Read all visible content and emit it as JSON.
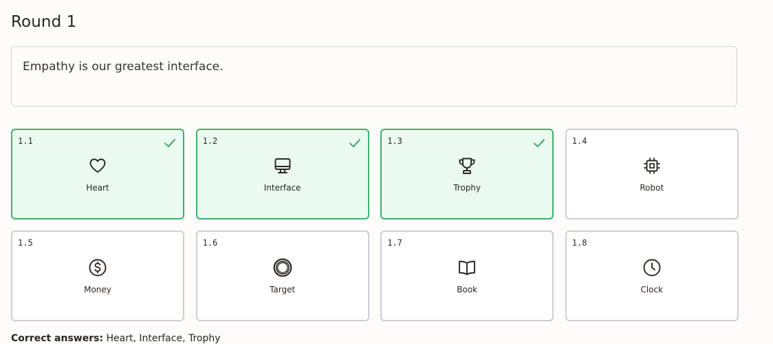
{
  "title": "Round 1",
  "prompt": "Empathy is our greatest interface.",
  "colors": {
    "selected_border": "#3bb26a",
    "selected_bg": "#ebfaf1",
    "check": "#2e9e58"
  },
  "options": [
    {
      "num": "1.1",
      "label": "Heart",
      "icon": "heart-icon",
      "selected": true
    },
    {
      "num": "1.2",
      "label": "Interface",
      "icon": "monitor-icon",
      "selected": true
    },
    {
      "num": "1.3",
      "label": "Trophy",
      "icon": "trophy-icon",
      "selected": true
    },
    {
      "num": "1.4",
      "label": "Robot",
      "icon": "chip-icon",
      "selected": false
    },
    {
      "num": "1.5",
      "label": "Money",
      "icon": "dollar-icon",
      "selected": false
    },
    {
      "num": "1.6",
      "label": "Target",
      "icon": "target-icon",
      "selected": false
    },
    {
      "num": "1.7",
      "label": "Book",
      "icon": "book-icon",
      "selected": false
    },
    {
      "num": "1.8",
      "label": "Clock",
      "icon": "clock-icon",
      "selected": false
    }
  ],
  "answers": {
    "label": "Correct answers:",
    "value": "Heart, Interface, Trophy"
  }
}
